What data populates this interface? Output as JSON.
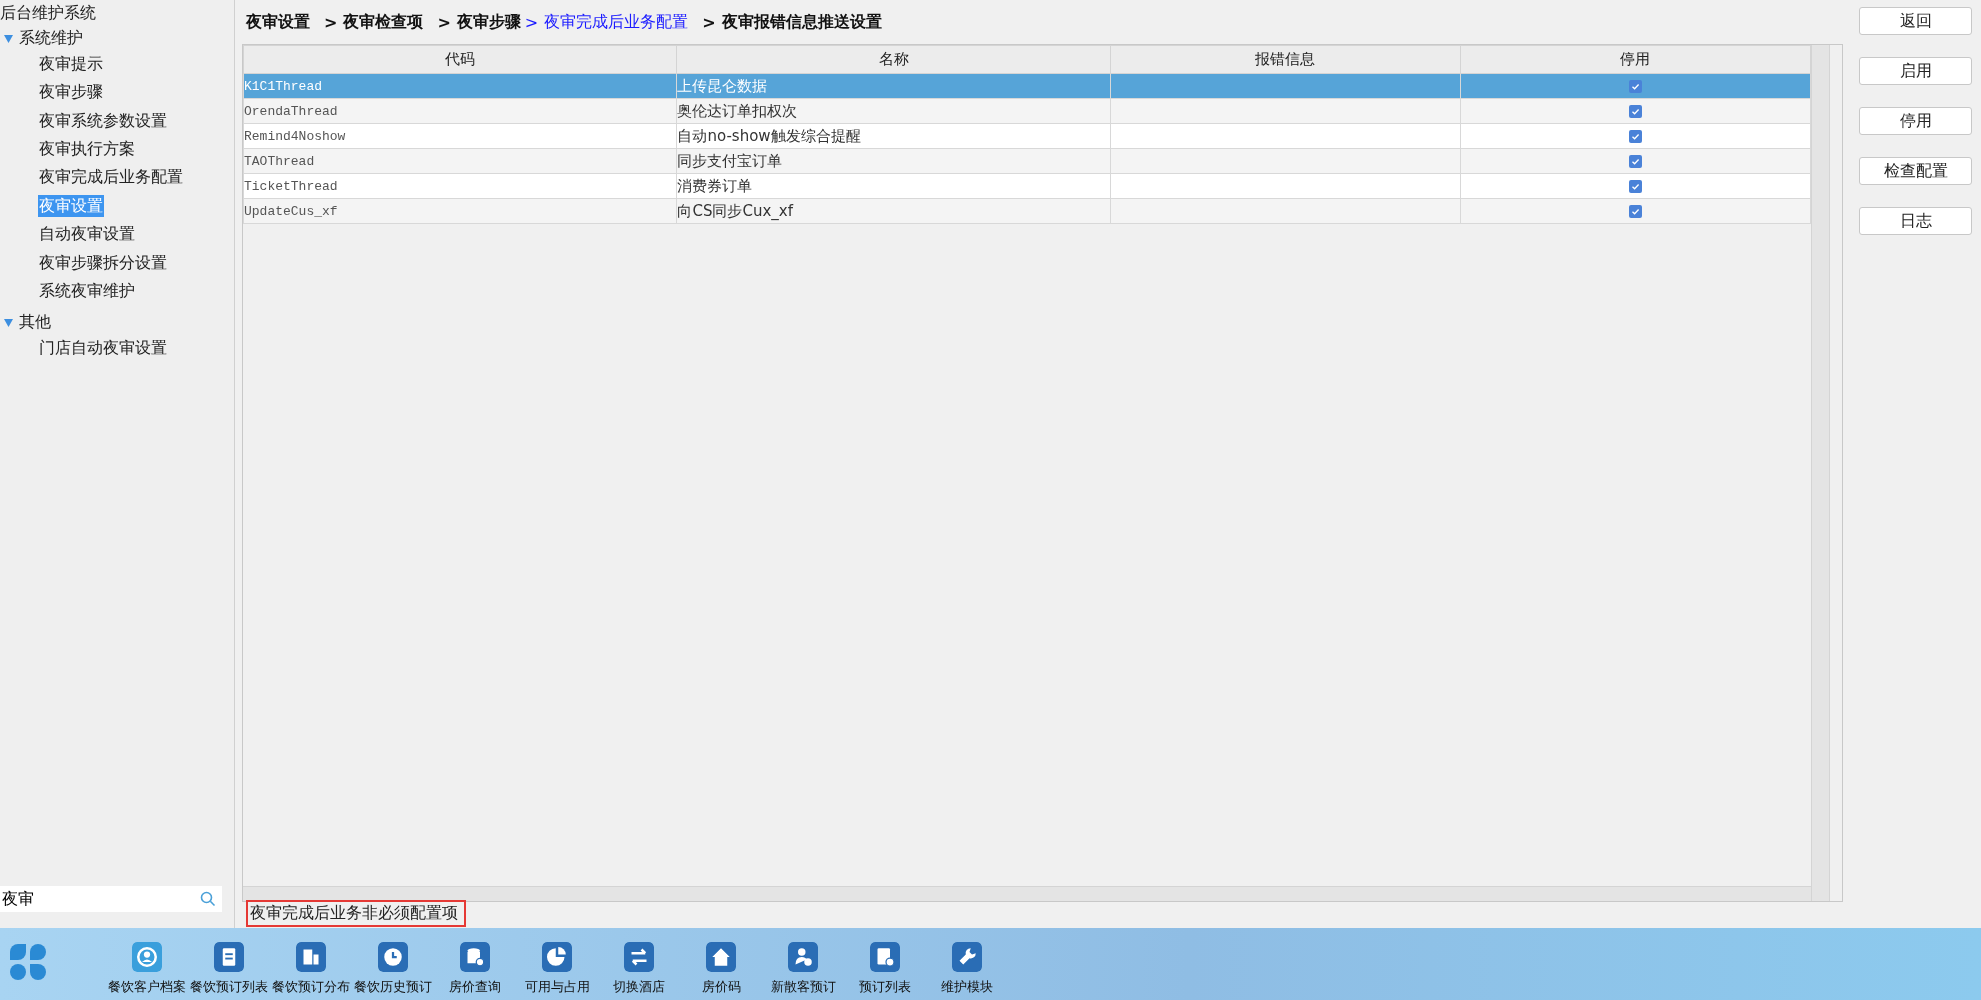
{
  "sidebar": {
    "title": "后台维护系统",
    "groups": [
      {
        "label": "系统维护",
        "expanded": true,
        "children": [
          {
            "label": "夜审提示",
            "selected": false
          },
          {
            "label": "夜审步骤",
            "selected": false
          },
          {
            "label": "夜审系统参数设置",
            "selected": false
          },
          {
            "label": "夜审执行方案",
            "selected": false
          },
          {
            "label": "夜审完成后业务配置",
            "selected": false
          },
          {
            "label": "夜审设置",
            "selected": true
          },
          {
            "label": "自动夜审设置",
            "selected": false
          },
          {
            "label": "夜审步骤拆分设置",
            "selected": false
          },
          {
            "label": "系统夜审维护",
            "selected": false
          }
        ]
      },
      {
        "label": "其他",
        "expanded": true,
        "children": [
          {
            "label": "门店自动夜审设置",
            "selected": false
          }
        ]
      }
    ],
    "search": {
      "value": "夜审"
    }
  },
  "breadcrumb": [
    {
      "label": "夜审设置",
      "selected": false
    },
    {
      "separator": ">",
      "label": "夜审检查项",
      "selected": false
    },
    {
      "separator": ">",
      "label": "夜审步骤",
      "selected": false
    },
    {
      "separator": ">",
      "label": "夜审完成后业务配置",
      "selected": true
    },
    {
      "separator": ">",
      "label": "夜审报错信息推送设置",
      "selected": false
    }
  ],
  "table": {
    "columns": [
      "代码",
      "名称",
      "报错信息",
      "停用"
    ],
    "rows": [
      {
        "code": "K1C1Thread",
        "name": "上传昆仑数据",
        "error": "",
        "disabled": true,
        "selected": true
      },
      {
        "code": "OrendaThread",
        "name": "奥伦达订单扣权次",
        "error": "",
        "disabled": true,
        "selected": false
      },
      {
        "code": "Remind4Noshow",
        "name": "自动no-show触发综合提醒",
        "error": "",
        "disabled": true,
        "selected": false
      },
      {
        "code": "TAOThread",
        "name": "同步支付宝订单",
        "error": "",
        "disabled": true,
        "selected": false
      },
      {
        "code": "TicketThread",
        "name": "消费券订单",
        "error": "",
        "disabled": true,
        "selected": false
      },
      {
        "code": "UpdateCus_xf",
        "name": "向CS同步Cux_xf",
        "error": "",
        "disabled": true,
        "selected": false
      }
    ]
  },
  "actions": [
    "返回",
    "启用",
    "停用",
    "检查配置",
    "日志"
  ],
  "status": "夜审完成后业务非必须配置项",
  "taskbar": [
    "餐饮客户档案",
    "餐饮预订列表",
    "餐饮预订分布",
    "餐饮历史预订",
    "房价查询",
    "可用与占用",
    "切换酒店",
    "房价码",
    "新散客预订",
    "预订列表",
    "维护模块"
  ]
}
